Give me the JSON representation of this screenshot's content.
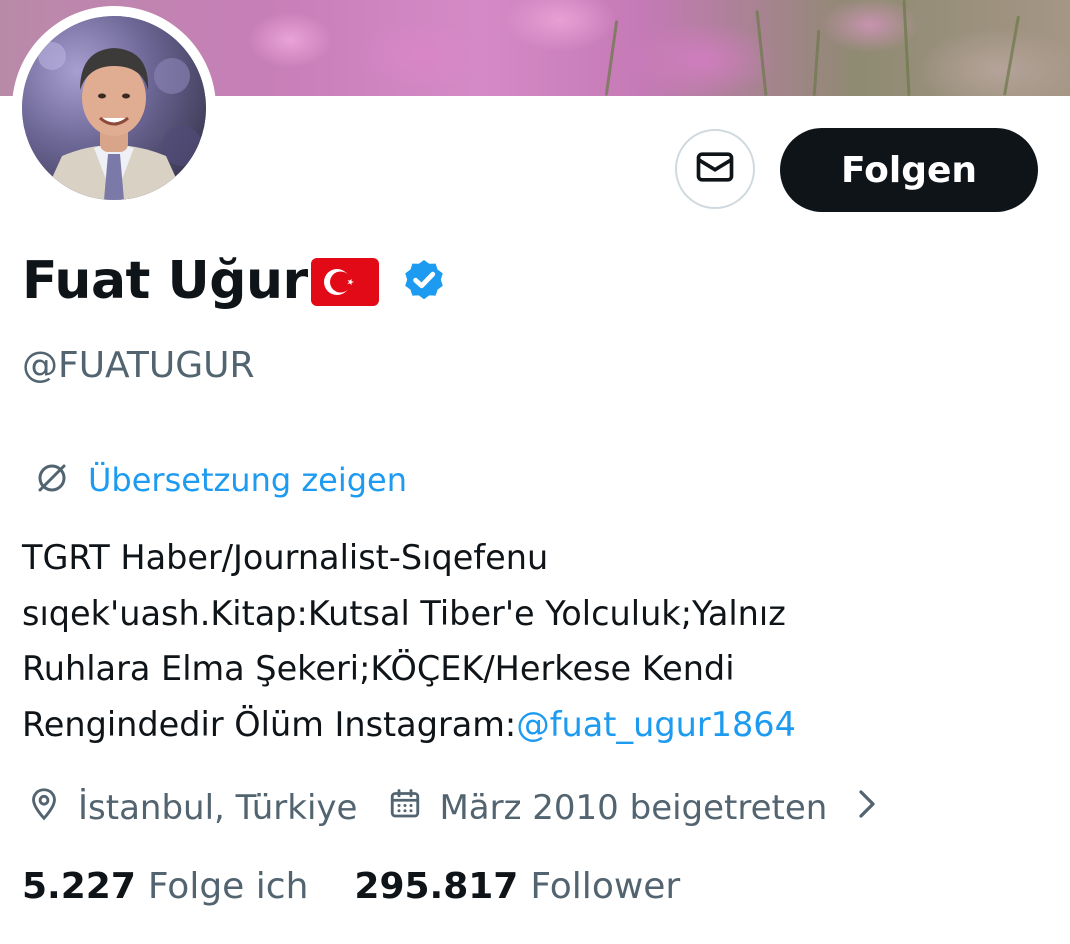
{
  "profile": {
    "display_name": "Fuat Uğur",
    "flag_icon": "turkey-flag-icon",
    "verified_icon": "verified-badge-icon",
    "handle": "@FUATUGUR"
  },
  "actions": {
    "message_icon": "envelope-icon",
    "follow_label": "Folgen"
  },
  "translate": {
    "icon": "translate-globe-icon",
    "label": "Übersetzung zeigen"
  },
  "bio": {
    "line1": "TGRT Haber/Journalist-Sıqefenu",
    "line2": "sıqek'uash.Kitap:Kutsal Tiber'e Yolculuk;Yalnız",
    "line3": "Ruhlara Elma Şekeri;KÖÇEK/Herkese Kendi",
    "line4_text": "Rengindedir Ölüm Instagram:",
    "line4_mention": "@fuat_ugur1864"
  },
  "meta": {
    "location_icon": "location-pin-icon",
    "location": "İstanbul, Türkiye",
    "joined_icon": "calendar-icon",
    "joined": "März 2010 beigetreten",
    "more_icon": "chevron-right-icon"
  },
  "stats": {
    "following_count": "5.227",
    "following_label": "Folge ich",
    "followers_count": "295.817",
    "followers_label": "Follower"
  },
  "colors": {
    "text_primary": "#0f1419",
    "text_secondary": "#536471",
    "accent_blue": "#1d9bf0",
    "button_dark": "#0f1419",
    "border": "#cfd9de"
  }
}
